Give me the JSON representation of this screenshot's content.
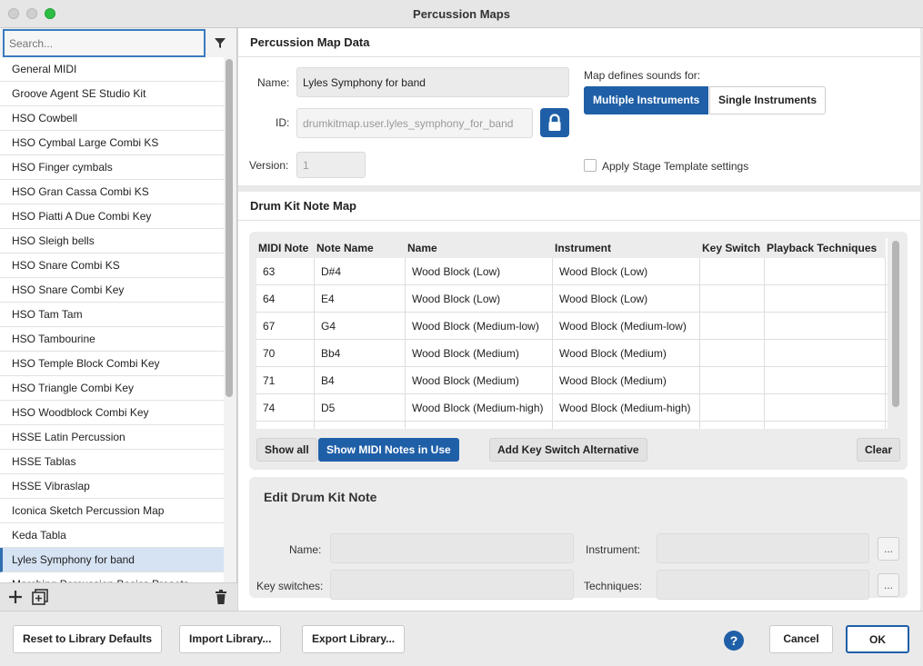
{
  "window": {
    "title": "Percussion Maps"
  },
  "sidebar": {
    "search_placeholder": "Search...",
    "items": [
      "General MIDI",
      "Groove Agent SE Studio Kit",
      "HSO Cowbell",
      "HSO Cymbal Large Combi KS",
      "HSO Finger cymbals",
      "HSO Gran Cassa Combi KS",
      "HSO Piatti A Due Combi Key",
      "HSO Sleigh bells",
      "HSO Snare Combi KS",
      "HSO Snare Combi Key",
      "HSO Tam Tam",
      "HSO Tambourine",
      "HSO Temple Block Combi Key",
      "HSO Triangle Combi Key",
      "HSO Woodblock Combi Key",
      "HSSE Latin Percussion",
      "HSSE Tablas",
      "HSSE Vibraslap",
      "Iconica Sketch Percussion Map",
      "Keda Tabla",
      "Lyles Symphony for band",
      "Marching Percussion Basics Presets"
    ],
    "selected_index": 20
  },
  "map_data": {
    "heading": "Percussion Map Data",
    "name_label": "Name:",
    "name_value": "Lyles Symphony for band",
    "id_label": "ID:",
    "id_value": "drumkitmap.user.lyles_symphony_for_band",
    "version_label": "Version:",
    "version_value": "1",
    "defines_label": "Map defines sounds for:",
    "multiple_label": "Multiple Instruments",
    "single_label": "Single Instruments",
    "stage_label": "Apply Stage Template settings"
  },
  "note_map": {
    "heading": "Drum Kit Note Map",
    "columns": [
      "MIDI Note",
      "Note Name",
      "Name",
      "Instrument",
      "Key Switch",
      "Playback Techniques"
    ],
    "rows": [
      [
        "63",
        "D#4",
        "Wood Block (Low)",
        "Wood Block (Low)",
        "",
        ""
      ],
      [
        "64",
        "E4",
        "Wood Block (Low)",
        "Wood Block (Low)",
        "",
        ""
      ],
      [
        "67",
        "G4",
        "Wood Block (Medium-low)",
        "Wood Block (Medium-low)",
        "",
        ""
      ],
      [
        "70",
        "Bb4",
        "Wood Block (Medium)",
        "Wood Block (Medium)",
        "",
        ""
      ],
      [
        "71",
        "B4",
        "Wood Block (Medium)",
        "Wood Block (Medium)",
        "",
        ""
      ],
      [
        "74",
        "D5",
        "Wood Block (Medium-high)",
        "Wood Block (Medium-high)",
        "",
        ""
      ],
      [
        "",
        "",
        "",
        "",
        "",
        ""
      ]
    ],
    "show_all": "Show all",
    "show_in_use": "Show MIDI Notes in Use",
    "add_key_switch": "Add Key Switch Alternative",
    "clear": "Clear"
  },
  "edit": {
    "heading": "Edit Drum Kit Note",
    "name_label": "Name:",
    "instrument_label": "Instrument:",
    "key_switches_label": "Key switches:",
    "techniques_label": "Techniques:",
    "dots": "..."
  },
  "footer": {
    "reset": "Reset to Library Defaults",
    "import": "Import Library...",
    "export": "Export Library...",
    "help": "?",
    "cancel": "Cancel",
    "ok": "OK"
  },
  "colors": {
    "accent": "#1f5fa7",
    "selection": "#d5e3f3"
  }
}
